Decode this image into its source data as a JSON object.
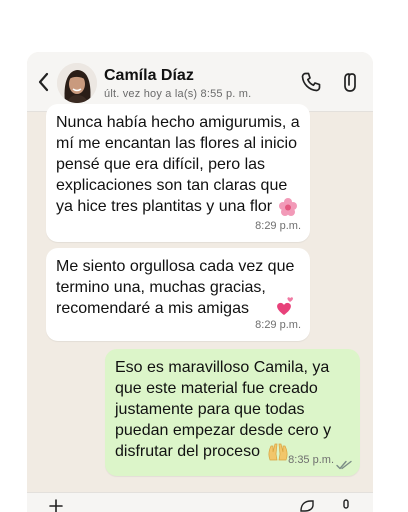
{
  "header": {
    "contact_name": "Camíla Díaz",
    "status": "últ. vez hoy a la(s)  8:55 p. m."
  },
  "messages": [
    {
      "direction": "incoming",
      "text": "Nunca había hecho amigurumis, a mí me encantan las flores al inicio pensé que era difícil, pero las explicaciones son tan claras que ya hice tres plantitas y una flor",
      "emoji": "pink-flower",
      "time": "8:29 p.m."
    },
    {
      "direction": "incoming",
      "text": "Me siento orgullosa cada vez que termino una, muchas gracias, recomendaré a mis amigas",
      "emoji": "sparkling-hearts",
      "time": "8:29 p.m."
    },
    {
      "direction": "outgoing",
      "text": "Eso es maravilloso Camila, ya que este material fue creado justamente para que todas puedan empezar desde cero y disfrutar del proceso",
      "emoji": "raised-hands",
      "time": "8:35 p.m.",
      "read_status": "double-check"
    }
  ],
  "icons": {
    "back": "chevron-left-icon",
    "call": "phone-icon",
    "video": "video-icon",
    "attach": "plus-icon",
    "sticker": "sticker-icon",
    "mic": "mic-icon"
  },
  "colors": {
    "incoming_bubble": "#ffffff",
    "outgoing_bubble": "#dcf5c9",
    "chat_background": "#f1ebe3",
    "read_ticks": "#53bdeb"
  }
}
